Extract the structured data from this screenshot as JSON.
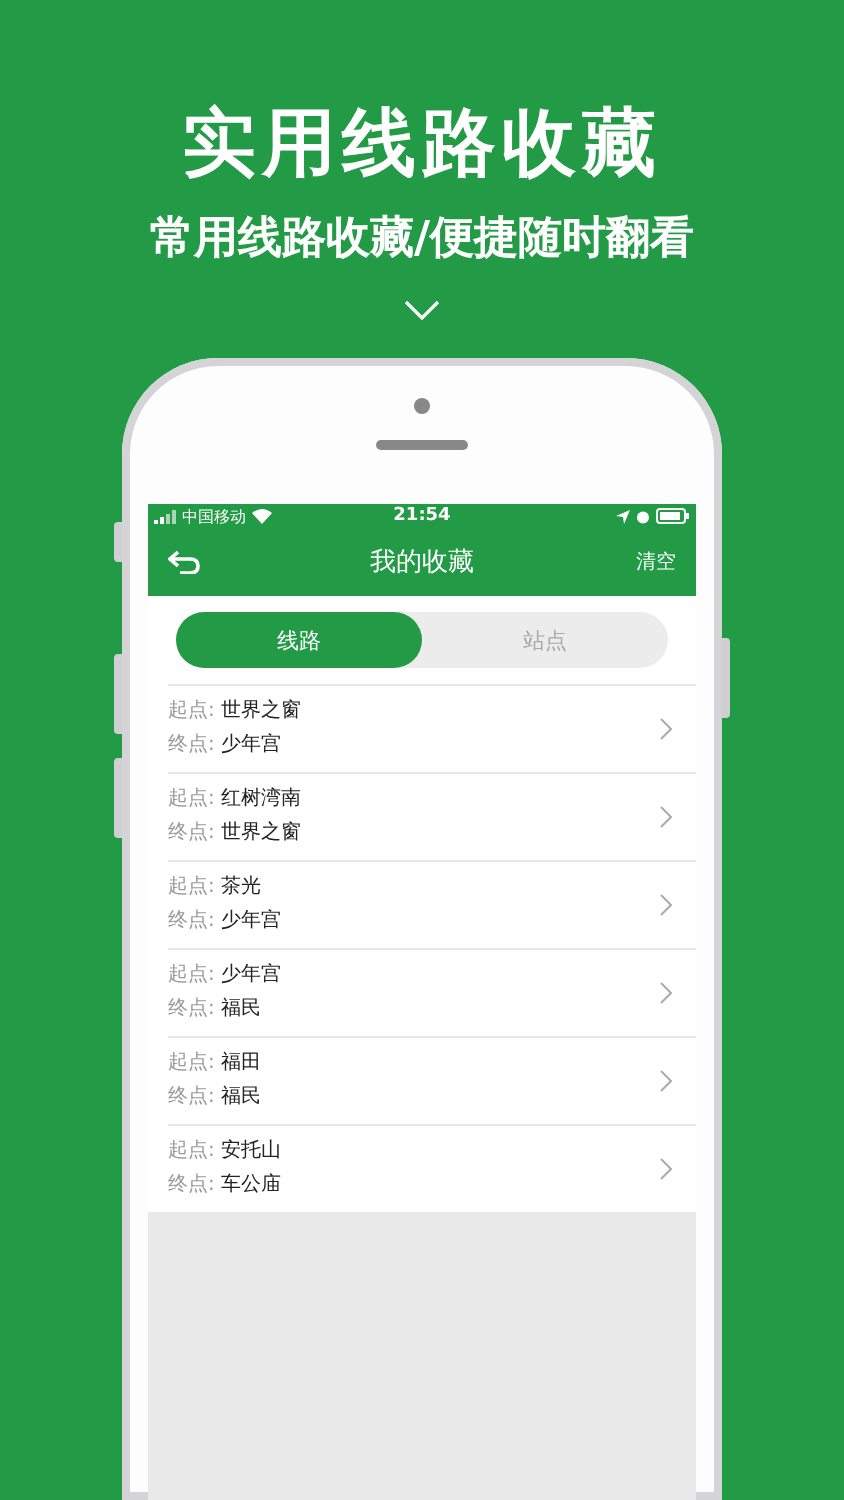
{
  "headline": "实用线路收藏",
  "subtitle": "常用线路收藏/便捷随时翻看",
  "status_bar": {
    "carrier": "中国移动",
    "time": "21:54"
  },
  "nav": {
    "title": "我的收藏",
    "action": "清空"
  },
  "tabs": [
    {
      "label": "线路",
      "selected": true
    },
    {
      "label": "站点",
      "selected": false
    }
  ],
  "routes": [
    {
      "start_label": "起点:",
      "start": "世界之窗",
      "end_label": "终点:",
      "end": "少年宫"
    },
    {
      "start_label": "起点:",
      "start": "红树湾南",
      "end_label": "终点:",
      "end": "世界之窗"
    },
    {
      "start_label": "起点:",
      "start": "茶光",
      "end_label": "终点:",
      "end": "少年宫"
    },
    {
      "start_label": "起点:",
      "start": "少年宫",
      "end_label": "终点:",
      "end": "福民"
    },
    {
      "start_label": "起点:",
      "start": "福田",
      "end_label": "终点:",
      "end": "福民"
    },
    {
      "start_label": "起点:",
      "start": "安托山",
      "end_label": "终点:",
      "end": "车公庙"
    }
  ]
}
